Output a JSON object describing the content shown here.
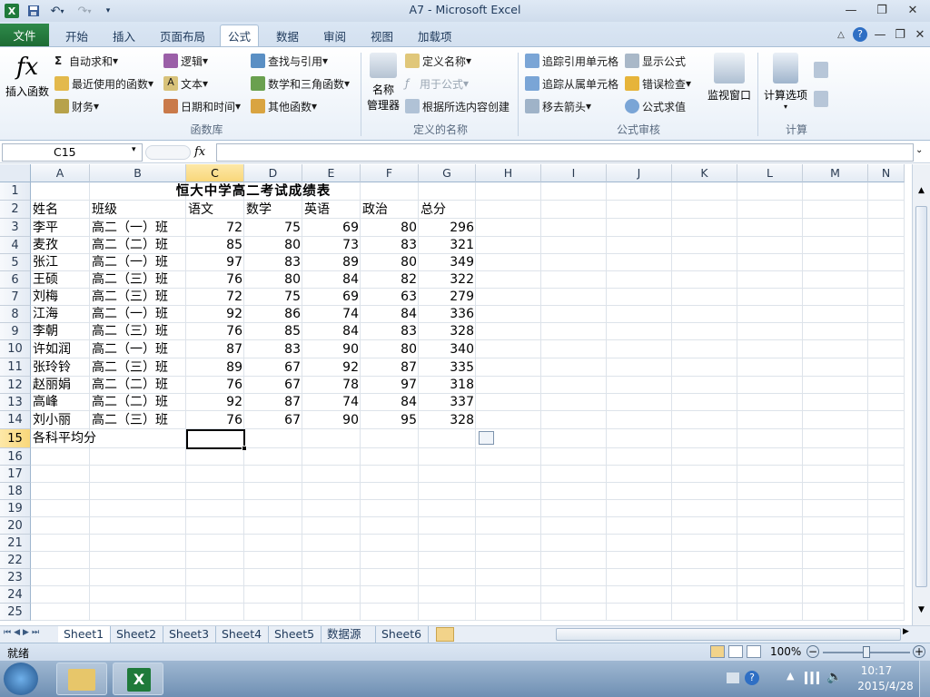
{
  "window": {
    "title": "A7  -  Microsoft Excel"
  },
  "tabs": [
    {
      "label": "文件"
    },
    {
      "label": "开始"
    },
    {
      "label": "插入"
    },
    {
      "label": "页面布局"
    },
    {
      "label": "公式"
    },
    {
      "label": "数据"
    },
    {
      "label": "审阅"
    },
    {
      "label": "视图"
    },
    {
      "label": "加载项"
    }
  ],
  "ribbon": {
    "insert_function": "插入函数",
    "autosum": "自动求和",
    "recent": "最近使用的函数",
    "financial": "财务",
    "logical": "逻辑",
    "text": "文本",
    "datetime": "日期和时间",
    "lookup": "查找与引用",
    "math": "数学和三角函数",
    "other": "其他函数",
    "group_library": "函数库",
    "name_manager_1": "名称",
    "name_manager_2": "管理器",
    "define_name": "定义名称",
    "use_in_formula": "用于公式",
    "create_from_sel": "根据所选内容创建",
    "group_names": "定义的名称",
    "trace_precedents": "追踪引用单元格",
    "trace_dependents": "追踪从属单元格",
    "remove_arrows": "移去箭头",
    "show_formulas": "显示公式",
    "error_checking": "错误检查",
    "evaluate": "公式求值",
    "watch_window": "监视窗口",
    "group_audit": "公式审核",
    "calc_options": "计算选项",
    "group_calc": "计算"
  },
  "formula_bar": {
    "name_box": "C15",
    "fx": "fx",
    "content": ""
  },
  "columns": [
    "A",
    "B",
    "C",
    "D",
    "E",
    "F",
    "G",
    "H",
    "I",
    "J",
    "K",
    "L",
    "M",
    "N"
  ],
  "rows": [
    "1",
    "2",
    "3",
    "4",
    "5",
    "6",
    "7",
    "8",
    "9",
    "10",
    "11",
    "12",
    "13",
    "14",
    "15",
    "16",
    "17",
    "18",
    "19",
    "20",
    "21",
    "22",
    "23",
    "24",
    "25"
  ],
  "sheet": {
    "title": "恒大中学高二考试成绩表",
    "headers": [
      "姓名",
      "班级",
      "语文",
      "数学",
      "英语",
      "政治",
      "总分"
    ],
    "records": [
      [
        "李平",
        "高二（一）班",
        "72",
        "75",
        "69",
        "80",
        "296"
      ],
      [
        "麦孜",
        "高二（二）班",
        "85",
        "80",
        "73",
        "83",
        "321"
      ],
      [
        "张江",
        "高二（一）班",
        "97",
        "83",
        "89",
        "80",
        "349"
      ],
      [
        "王硕",
        "高二（三）班",
        "76",
        "80",
        "84",
        "82",
        "322"
      ],
      [
        "刘梅",
        "高二（三）班",
        "72",
        "75",
        "69",
        "63",
        "279"
      ],
      [
        "江海",
        "高二（一）班",
        "92",
        "86",
        "74",
        "84",
        "336"
      ],
      [
        "李朝",
        "高二（三）班",
        "76",
        "85",
        "84",
        "83",
        "328"
      ],
      [
        "许如润",
        "高二（一）班",
        "87",
        "83",
        "90",
        "80",
        "340"
      ],
      [
        "张玲铃",
        "高二（三）班",
        "89",
        "67",
        "92",
        "87",
        "335"
      ],
      [
        "赵丽娟",
        "高二（二）班",
        "76",
        "67",
        "78",
        "97",
        "318"
      ],
      [
        "高峰",
        "高二（二）班",
        "92",
        "87",
        "74",
        "84",
        "337"
      ],
      [
        "刘小丽",
        "高二（三）班",
        "76",
        "67",
        "90",
        "95",
        "328"
      ]
    ],
    "footer_label": "各科平均分"
  },
  "sheet_tabs": [
    "Sheet1",
    "Sheet2",
    "Sheet3",
    "Sheet4",
    "Sheet5",
    "数据源",
    "Sheet6"
  ],
  "status": {
    "ready": "就绪",
    "zoom": "100%"
  },
  "taskbar": {
    "time": "10:17",
    "date": "2015/4/28"
  }
}
